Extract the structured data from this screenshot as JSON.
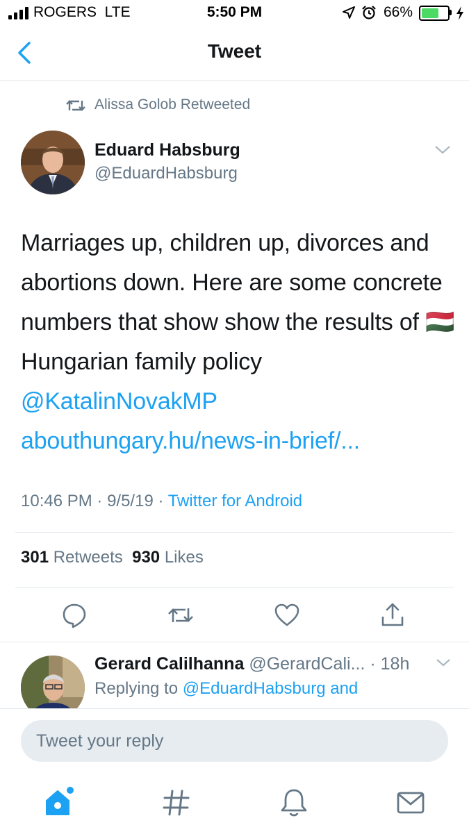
{
  "status_bar": {
    "carrier": "ROGERS  LTE",
    "time": "5:50 PM",
    "battery_percent": "66%",
    "battery_level": 0.66
  },
  "header": {
    "title": "Tweet"
  },
  "tweet": {
    "retweeted_by": "Alissa Golob Retweeted",
    "author_name": "Eduard Habsburg",
    "author_handle": "@EduardHabsburg",
    "text_before_flag": "Marriages up, children up, divorces and abortions down. Here are some concrete numbers that show show the results of ",
    "flag": "🇭🇺",
    "text_after_flag": " Hungarian family policy ",
    "mention": "@KatalinNovakMP",
    "url": "abouthungary.hu/news-in-brief/...",
    "time": "10:46 PM",
    "date": "9/5/19",
    "source": "Twitter for Android",
    "retweets_count": "301",
    "retweets_label": "Retweets",
    "likes_count": "930",
    "likes_label": "Likes"
  },
  "actions": [
    "reply-icon",
    "retweet-icon",
    "like-icon",
    "share-icon"
  ],
  "reply": {
    "author_name": "Gerard Calilhanna",
    "author_handle": "@GerardCali...",
    "age": "· 18h",
    "replying_prefix": "Replying to",
    "replying_to": "@EduardHabsburg and"
  },
  "composer": {
    "placeholder": "Tweet your reply"
  },
  "tabs": [
    "home-icon",
    "explore-icon",
    "notifications-icon",
    "messages-icon"
  ],
  "colors": {
    "accent": "#1da1f2",
    "muted": "#657786",
    "text": "#14171a",
    "divider": "#e1e8ed"
  }
}
